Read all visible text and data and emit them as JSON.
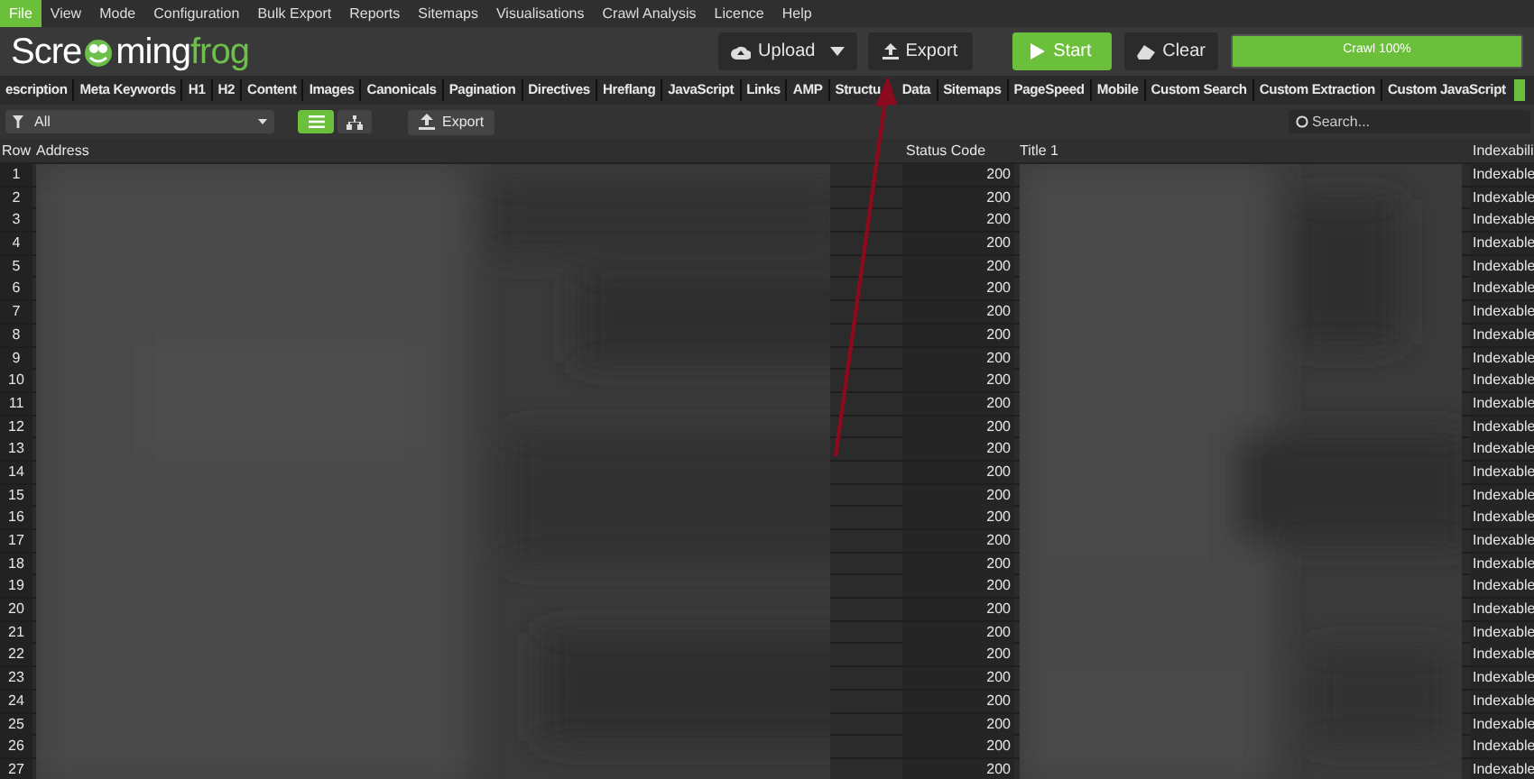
{
  "menu": [
    {
      "label": "File",
      "selected": true
    },
    {
      "label": "View",
      "selected": false
    },
    {
      "label": "Mode",
      "selected": false
    },
    {
      "label": "Configuration",
      "selected": false
    },
    {
      "label": "Bulk Export",
      "selected": false
    },
    {
      "label": "Reports",
      "selected": false
    },
    {
      "label": "Sitemaps",
      "selected": false
    },
    {
      "label": "Visualisations",
      "selected": false
    },
    {
      "label": "Crawl Analysis",
      "selected": false
    },
    {
      "label": "Licence",
      "selected": false
    },
    {
      "label": "Help",
      "selected": false
    }
  ],
  "logo": {
    "text_a": "Scre",
    "text_b": "ming",
    "text_c": "frog"
  },
  "toolbar": {
    "upload": "Upload",
    "export": "Export",
    "start": "Start",
    "clear": "Clear",
    "progress": {
      "label": "Crawl 100%",
      "level": 1
    }
  },
  "tabs": [
    {
      "label": "escription"
    },
    {
      "label": "Meta Keywords"
    },
    {
      "label": "H1"
    },
    {
      "label": "H2"
    },
    {
      "label": "Content"
    },
    {
      "label": "Images"
    },
    {
      "label": "Canonicals"
    },
    {
      "label": "Pagination"
    },
    {
      "label": "Directives"
    },
    {
      "label": "Hreflang"
    },
    {
      "label": "JavaScript"
    },
    {
      "label": "Links"
    },
    {
      "label": "AMP"
    },
    {
      "label": "Structu",
      "label_2": "Data"
    },
    {
      "label": "Sitemaps"
    },
    {
      "label": "PageSpeed"
    },
    {
      "label": "Mobile"
    },
    {
      "label": "Custom Search"
    },
    {
      "label": "Custom Extraction"
    },
    {
      "label": "Custom JavaScript"
    }
  ],
  "filter": {
    "value": "All",
    "view_list_selected": true,
    "view_tree_selected": false,
    "export": "Export",
    "search_placeholder": "Search..."
  },
  "table": {
    "columns": [
      "Row",
      "Address",
      "Status Code",
      "Title 1",
      "Indexabili"
    ],
    "rows": [
      {
        "row": "1",
        "status_code": "200",
        "indexability": "Indexable"
      },
      {
        "row": "2",
        "status_code": "200",
        "indexability": "Indexable"
      },
      {
        "row": "3",
        "status_code": "200",
        "indexability": "Indexable"
      },
      {
        "row": "4",
        "status_code": "200",
        "indexability": "Indexable"
      },
      {
        "row": "5",
        "status_code": "200",
        "indexability": "Indexable"
      },
      {
        "row": "6",
        "status_code": "200",
        "indexability": "Indexable"
      },
      {
        "row": "7",
        "status_code": "200",
        "indexability": "Indexable"
      },
      {
        "row": "8",
        "status_code": "200",
        "indexability": "Indexable"
      },
      {
        "row": "9",
        "status_code": "200",
        "indexability": "Indexable"
      },
      {
        "row": "10",
        "status_code": "200",
        "indexability": "Indexable"
      },
      {
        "row": "11",
        "status_code": "200",
        "indexability": "Indexable"
      },
      {
        "row": "12",
        "status_code": "200",
        "indexability": "Indexable"
      },
      {
        "row": "13",
        "status_code": "200",
        "indexability": "Indexable"
      },
      {
        "row": "14",
        "status_code": "200",
        "indexability": "Indexable"
      },
      {
        "row": "15",
        "status_code": "200",
        "indexability": "Indexable"
      },
      {
        "row": "16",
        "status_code": "200",
        "indexability": "Indexable"
      },
      {
        "row": "17",
        "status_code": "200",
        "indexability": "Indexable"
      },
      {
        "row": "18",
        "status_code": "200",
        "indexability": "Indexable"
      },
      {
        "row": "19",
        "status_code": "200",
        "indexability": "Indexable"
      },
      {
        "row": "20",
        "status_code": "200",
        "indexability": "Indexable"
      },
      {
        "row": "21",
        "status_code": "200",
        "indexability": "Indexable"
      },
      {
        "row": "22",
        "status_code": "200",
        "indexability": "Indexable"
      },
      {
        "row": "23",
        "status_code": "200",
        "indexability": "Indexable"
      },
      {
        "row": "24",
        "status_code": "200",
        "indexability": "Indexable"
      },
      {
        "row": "25",
        "status_code": "200",
        "indexability": "Indexable"
      },
      {
        "row": "26",
        "status_code": "200",
        "indexability": "Indexable"
      },
      {
        "row": "27",
        "status_code": "200",
        "indexability": "Indexable"
      }
    ]
  }
}
